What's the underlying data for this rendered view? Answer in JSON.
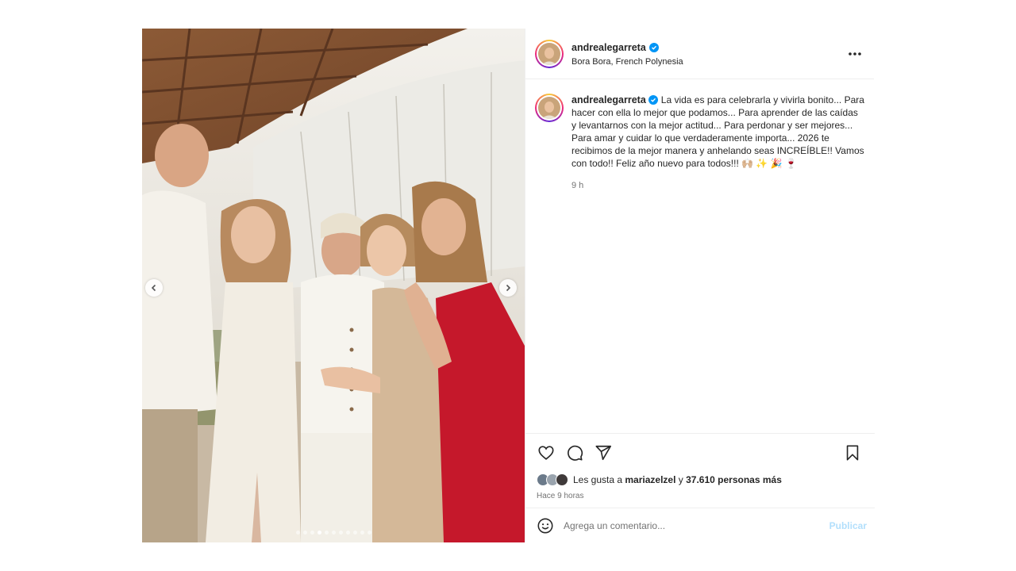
{
  "post": {
    "username": "andrealegarreta",
    "location": "Bora Bora, French Polynesia",
    "more_icon": "more-horizontal-icon",
    "verified_icon": "verified-badge-icon"
  },
  "carousel": {
    "total_slides": 11,
    "active_index": 3,
    "prev_icon": "chevron-left-icon",
    "next_icon": "chevron-right-icon"
  },
  "caption": {
    "username": "andrealegarreta",
    "text": "La vida es para celebrarla y vivirla bonito... Para hacer con ella lo mejor que podamos... Para aprender de las caídas y levantarnos con la mejor actitud... Para perdonar y ser mejores... Para amar y cuidar lo que verdaderamente importa... 2026 te recibimos de la mejor manera y anhelando seas INCREÍBLE!! Vamos con todo!! Feliz año nuevo para todos!!! 🙌🏼 ✨ 🎉 🍷",
    "time": "9 h"
  },
  "actions": {
    "like_icon": "heart-icon",
    "comment_icon": "comment-icon",
    "share_icon": "send-icon",
    "save_icon": "bookmark-icon"
  },
  "likes": {
    "prefix": "Les gusta a",
    "user": "mariazelzel",
    "middle": "y",
    "count_text": "37.610 personas más"
  },
  "posted_ago": "Hace 9 horas",
  "comment": {
    "placeholder": "Agrega un comentario...",
    "emoji_icon": "smiley-icon",
    "publish_label": "Publicar"
  },
  "colors": {
    "accent": "#0095f6",
    "publish_disabled": "#b2dffc",
    "secondary_text": "#737373"
  }
}
